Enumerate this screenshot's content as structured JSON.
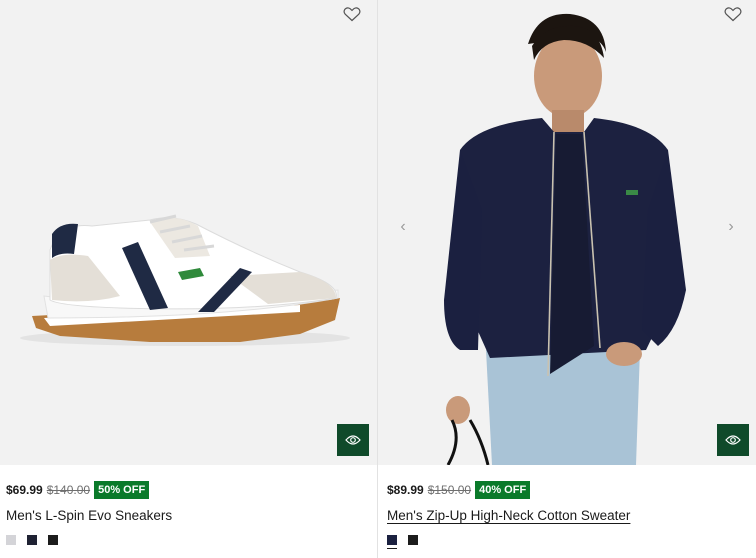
{
  "products": [
    {
      "name": "Men's L-Spin Evo Sneakers",
      "price": "$69.99",
      "original_price": "$140.00",
      "discount_badge": "50% OFF",
      "swatch_colors": [
        "#d4d4d8",
        "#1f2233",
        "#1c1c1c"
      ],
      "favorite_icon": "heart-outline-icon",
      "quick_view_icon": "eye-icon"
    },
    {
      "name": "Men's Zip-Up High-Neck Cotton Sweater",
      "price": "$89.99",
      "original_price": "$150.00",
      "discount_badge": "40% OFF",
      "swatch_colors": [
        "#1b2140",
        "#1c1c1c"
      ],
      "favorite_icon": "heart-outline-icon",
      "quick_view_icon": "eye-icon",
      "carousel": {
        "prev_icon": "‹",
        "next_icon": "›"
      }
    }
  ],
  "colors": {
    "badge": "#0a7a2a",
    "quick_view_bg": "#0f4a2a",
    "image_bg": "#f2f2f2"
  }
}
